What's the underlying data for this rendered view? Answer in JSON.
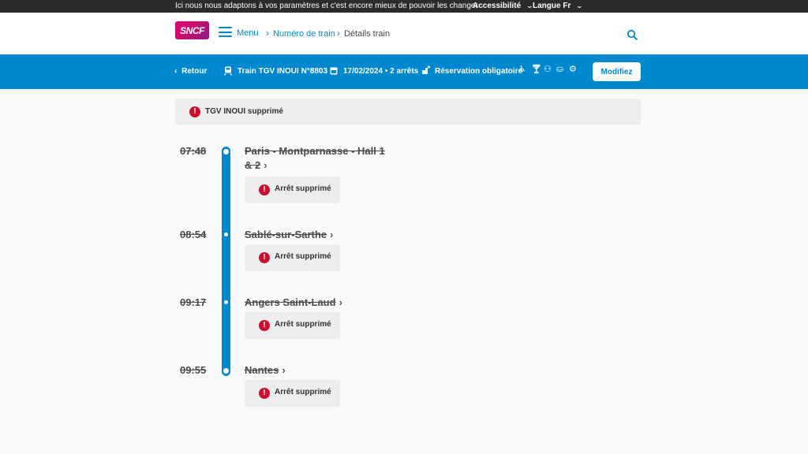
{
  "topbar": {
    "message": "Ici nous nous adaptons à vos paramètres et c'est encore mieux de pouvoir les changer",
    "accessibility": "Accessibilité",
    "language": "Langue Fr"
  },
  "header": {
    "logo_text": "SNCF",
    "menu_label": "Menu",
    "breadcrumb": [
      "Numéro de train",
      "Détails train"
    ]
  },
  "train_bar": {
    "back_label": "Retour",
    "train_label": "Train TGV INOUI N°8803",
    "date_stops": "17/02/2024 • 2 arrêts",
    "reservation": "Réservation obligatoire",
    "modify_label": "Modifiez"
  },
  "alert": {
    "text": "TGV INOUI supprimé"
  },
  "stops": [
    {
      "time": "07:48",
      "station": "Paris - Montparnasse - Hall 1 & 2",
      "status": "Arrêt supprimé"
    },
    {
      "time": "08:54",
      "station": "Sablé-sur-Sarthe",
      "status": "Arrêt supprimé"
    },
    {
      "time": "09:17",
      "station": "Angers Saint-Laud",
      "status": "Arrêt supprimé"
    },
    {
      "time": "09:55",
      "station": "Nantes",
      "status": "Arrêt supprimé"
    }
  ],
  "colors": {
    "brand_blue": "#0088ce",
    "alert_red": "#c8102e",
    "topbar_bg": "#2b2b2b"
  }
}
